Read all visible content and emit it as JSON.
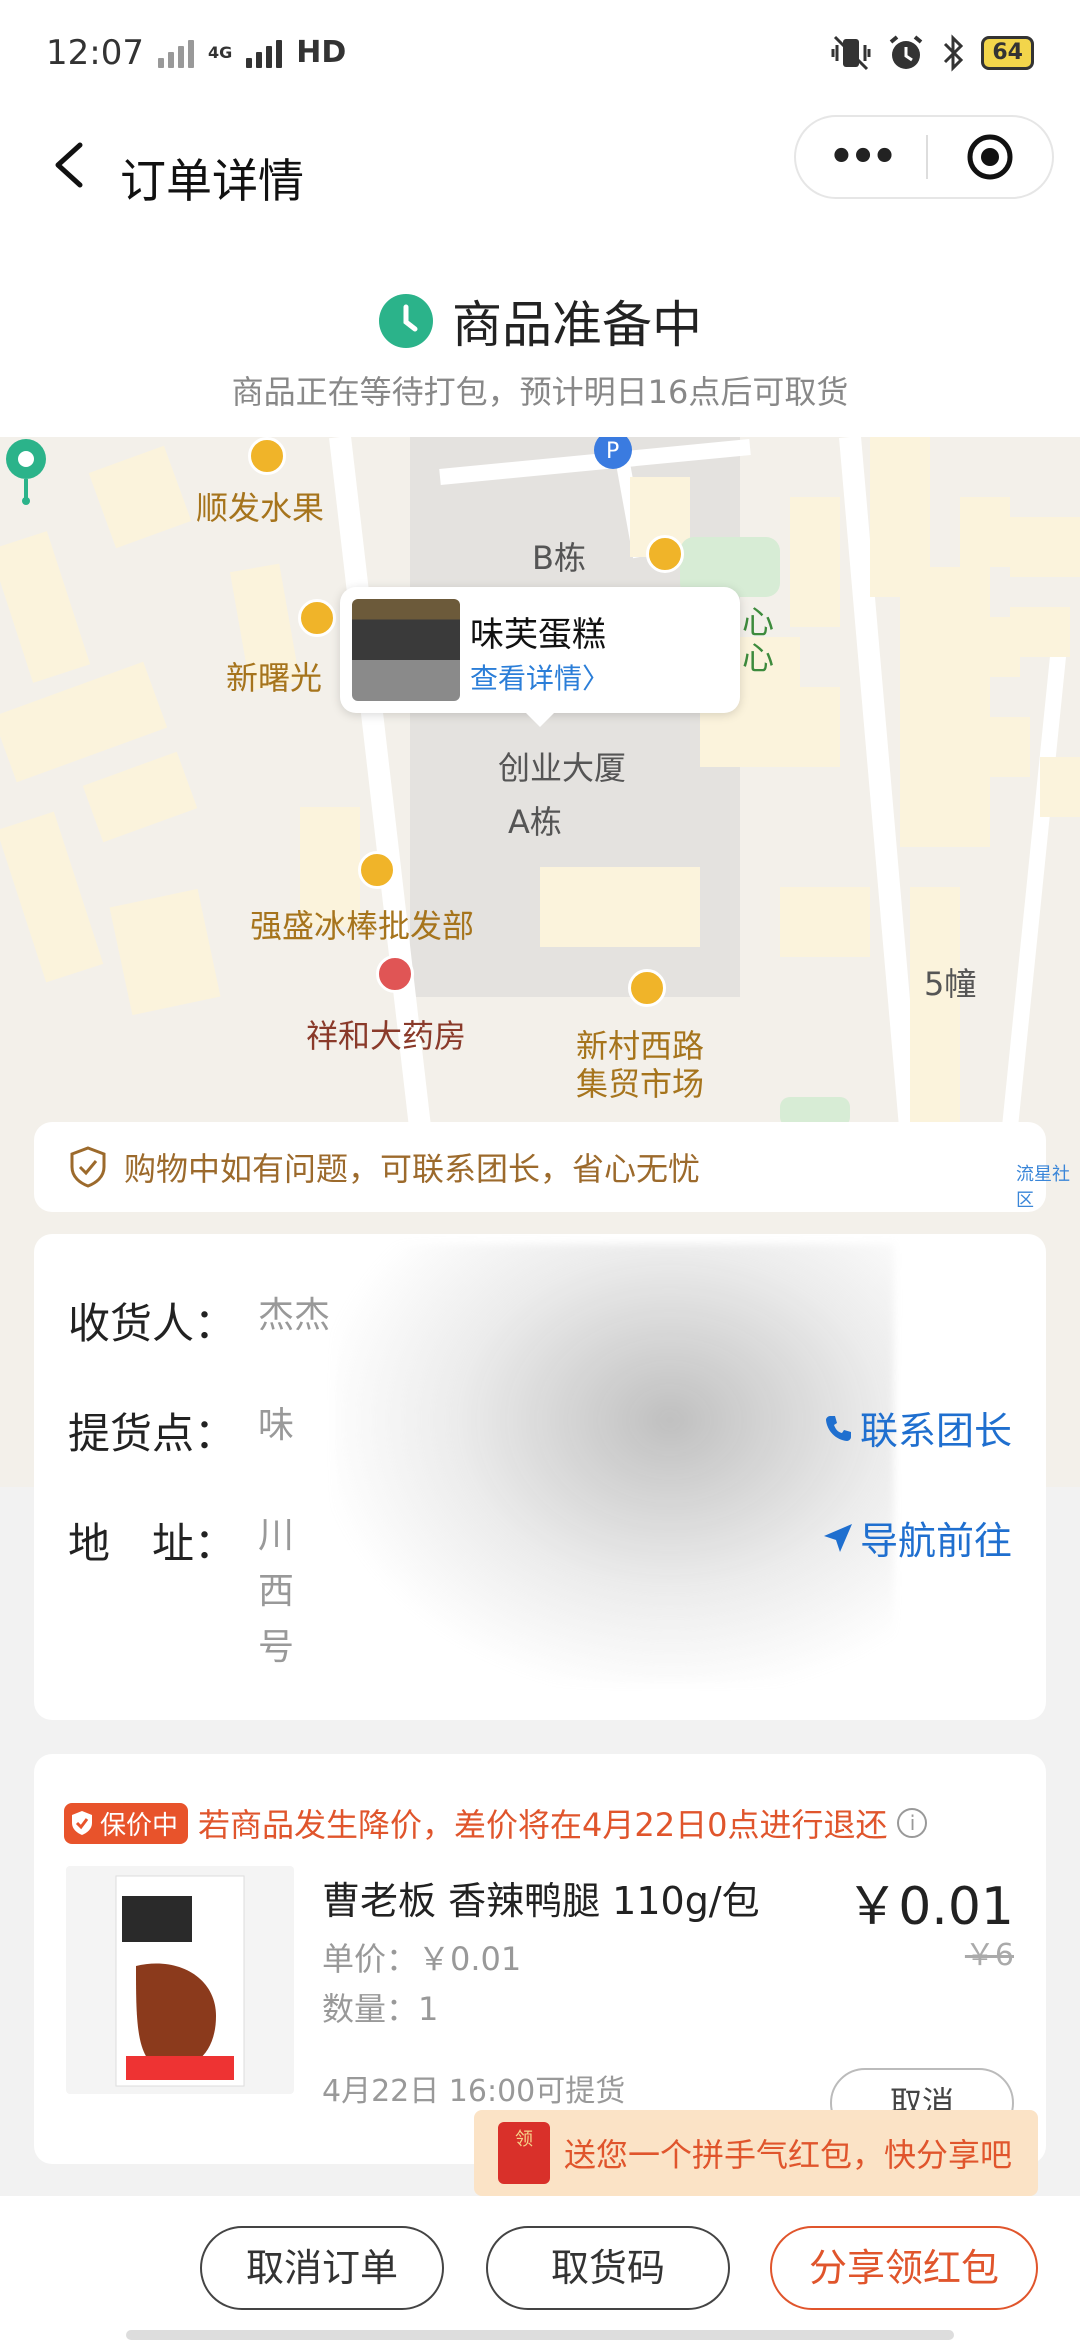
{
  "status_bar": {
    "time": "12:07",
    "network": "4G",
    "hd": "HD",
    "battery": "64"
  },
  "nav": {
    "title": "订单详情",
    "more_label": "•••"
  },
  "status": {
    "title": "商品准备中",
    "subtitle": "商品正在等待打包，预计明日16点后可取货"
  },
  "map": {
    "labels": {
      "shunfa": "顺发水果",
      "b_building": "B栋",
      "xinshuguang": "新曙光",
      "building": "创业大厦",
      "a_building": "A栋",
      "qiangsheng": "强盛冰棒批发部",
      "xianghe": "祥和大药房",
      "market_line1": "新村西路",
      "market_line2": "集贸市场",
      "building5": "5幢",
      "center": "心",
      "edge": "流星社区"
    },
    "callout": {
      "name": "味芙蛋糕",
      "link": "查看详情〉"
    }
  },
  "notice": {
    "text": "购物中如有问题，可联系团长，省心无忧"
  },
  "delivery": {
    "receiver_label": "收货人：",
    "receiver_value": "杰杰",
    "pickup_label": "提货点：",
    "pickup_value": "味",
    "address_label": "地　址：",
    "address_lines": [
      "川",
      "西",
      "号"
    ],
    "contact_action": "联系团长",
    "nav_action": "导航前往"
  },
  "order": {
    "badge": "保价中",
    "protect_text": "若商品发生降价，差价将在4月22日0点进行退还",
    "product_name": "曹老板 香辣鸭腿 110g/包",
    "price": "￥0.01",
    "original_price": "￥6",
    "unit_price": "单价：￥0.01",
    "quantity": "数量：1",
    "pickup_time": "4月22日 16:00可提货",
    "cancel_label": "取消"
  },
  "tooltip": {
    "envelope": "领",
    "text": "送您一个拼手气红包，快分享吧"
  },
  "bottom": {
    "cancel_order": "取消订单",
    "pickup_code": "取货码",
    "share": "分享领红包"
  },
  "colors": {
    "accent_orange": "#e0552c",
    "link_blue": "#1f6fcf",
    "status_green": "#2bb38a"
  }
}
